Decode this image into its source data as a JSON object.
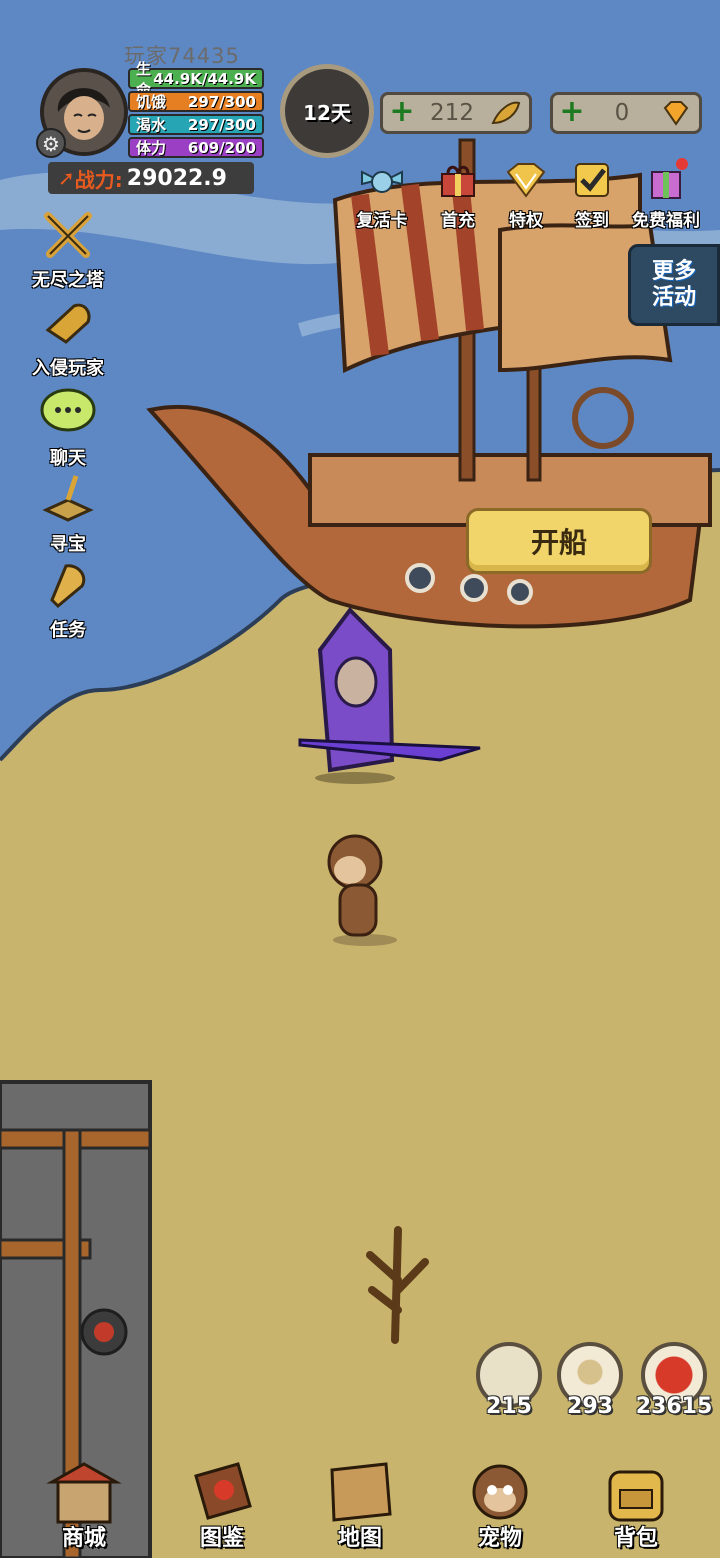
{
  "player": {
    "name": "玩家74435",
    "stats": [
      {
        "label": "生命",
        "value": "44.9K/44.9K",
        "color": "#4caf50"
      },
      {
        "label": "饥饿",
        "value": "297/300",
        "color": "#e67e22"
      },
      {
        "label": "渴水",
        "value": "297/300",
        "color": "#26a6b5"
      },
      {
        "label": "体力",
        "value": "609/200",
        "color": "#9b3fc4"
      }
    ],
    "power_label": "战力:",
    "power_value": "29022.9"
  },
  "day_label": "12天",
  "currency": [
    {
      "amount": "212",
      "icon": "feather-icon"
    },
    {
      "amount": "0",
      "icon": "diamond-icon"
    }
  ],
  "top_events": [
    {
      "label": "复活卡",
      "icon": "winged-crest-icon"
    },
    {
      "label": "首充",
      "icon": "gift-chest-icon"
    },
    {
      "label": "特权",
      "icon": "gem-crown-icon"
    },
    {
      "label": "签到",
      "icon": "checkmark-icon"
    },
    {
      "label": "免费福利",
      "icon": "gift-box-icon"
    }
  ],
  "more_activities": "更多活动",
  "left_menu": [
    {
      "label": "无尽之塔",
      "icon": "crossed-swords-icon"
    },
    {
      "label": "入侵玩家",
      "icon": "horn-icon"
    },
    {
      "label": "聊天",
      "icon": "chat-bubble-icon"
    },
    {
      "label": "寻宝",
      "icon": "treasure-icon"
    },
    {
      "label": "任务",
      "icon": "bell-icon"
    }
  ],
  "set_sail_button": "开船",
  "resources": [
    {
      "amount": "215",
      "icon": "food-plate-icon"
    },
    {
      "amount": "293",
      "icon": "egg-icon"
    },
    {
      "amount": "23615",
      "icon": "apple-icon"
    }
  ],
  "bottom_nav": [
    {
      "label": "商城",
      "icon": "shop-icon"
    },
    {
      "label": "图鉴",
      "icon": "book-icon"
    },
    {
      "label": "地图",
      "icon": "map-icon"
    },
    {
      "label": "宠物",
      "icon": "monkey-icon"
    },
    {
      "label": "背包",
      "icon": "backpack-icon"
    }
  ]
}
